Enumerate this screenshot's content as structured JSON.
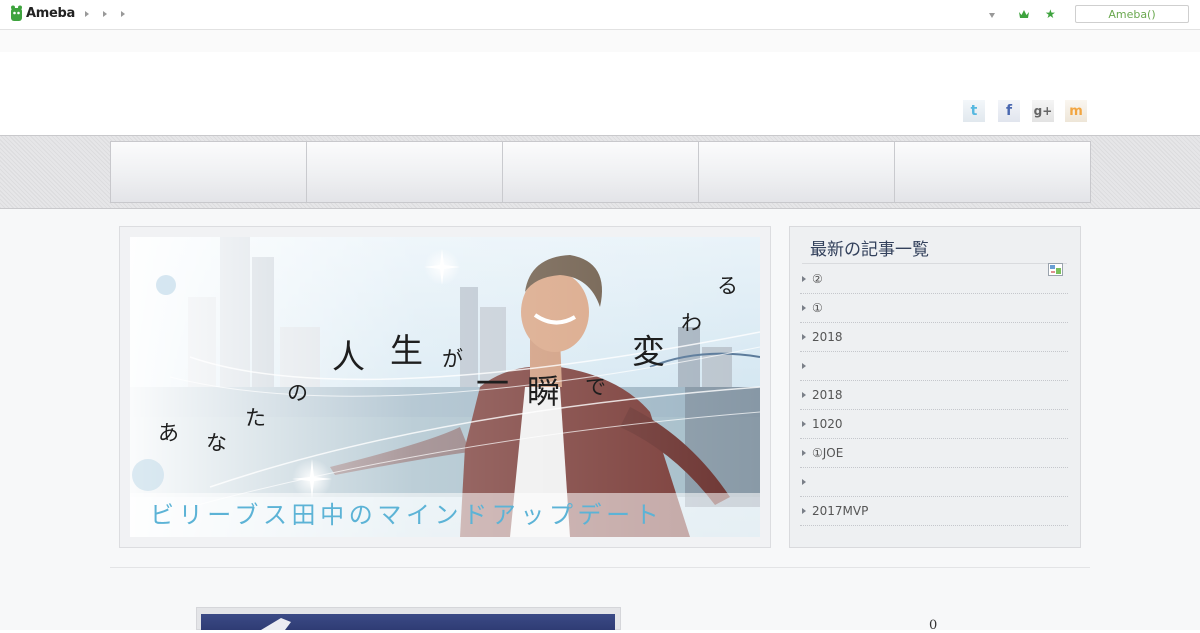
{
  "topbar": {
    "logo_text": "Ameba",
    "account_button": "Ameba()",
    "icons": [
      "ameba-logo-icon",
      "chevron-down-icon",
      "crown-icon",
      "star-icon"
    ],
    "accent_color": "#3ea33e"
  },
  "social": {
    "twitter": "t",
    "facebook": "f",
    "googleplus": "g+",
    "mixi": "m"
  },
  "nav": {
    "items": [
      "",
      "",
      "",
      "",
      ""
    ]
  },
  "header": {
    "main_chars": [
      "あ",
      "な",
      "た",
      "の",
      "人",
      "生",
      "が",
      "一",
      "瞬",
      "で",
      "変",
      "わ",
      "る"
    ],
    "subtitle": "ビリーブス田中のマインドアップデート",
    "subtitle_color": "#5cb3d6"
  },
  "sidebar": {
    "title": "最新の記事一覧",
    "items": [
      "②",
      "①",
      "2018",
      "",
      "2018",
      "1020",
      "①JOE",
      "",
      "2017MVP"
    ]
  },
  "footer": {
    "count": "0"
  }
}
